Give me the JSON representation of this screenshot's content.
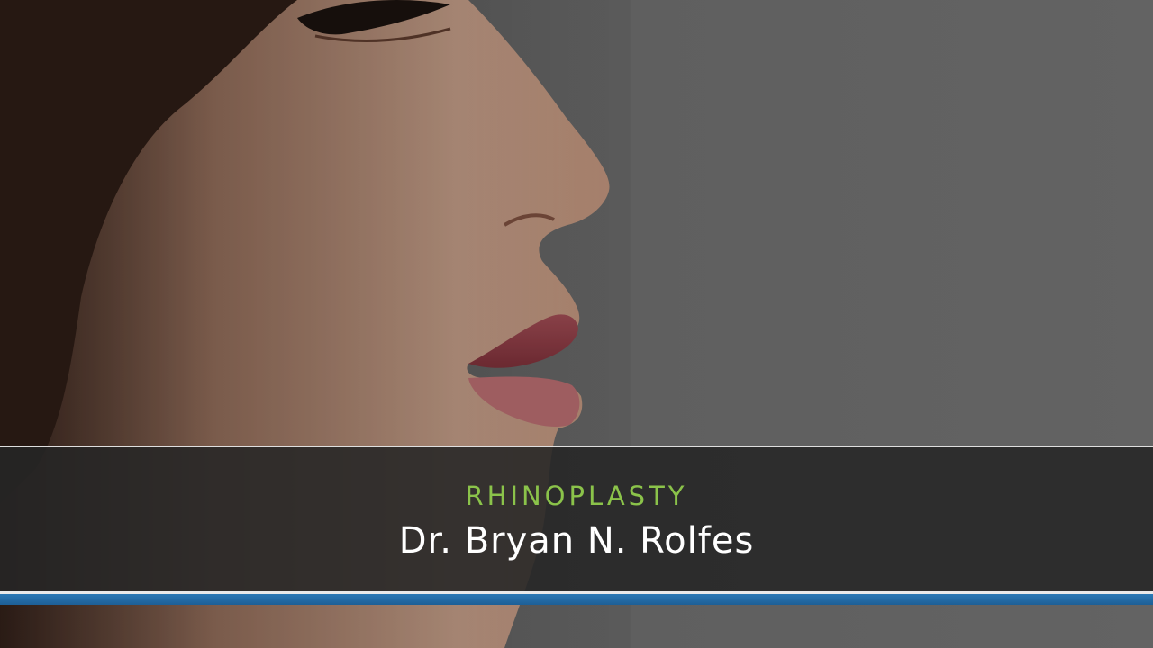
{
  "lower_third": {
    "eyebrow": "RHINOPLASTY",
    "headline": "Dr. Bryan N. Rolfes"
  },
  "colors": {
    "eyebrow": "#8bc34a",
    "headline": "#ffffff",
    "panel": "#262626",
    "accent_stripe": "#2570aa",
    "background": "#6b6b6b"
  }
}
